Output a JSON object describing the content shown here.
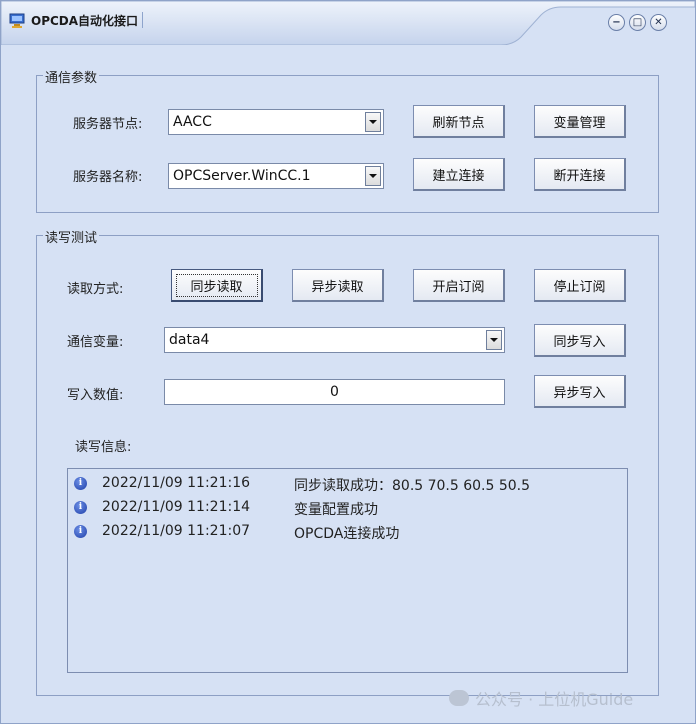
{
  "window": {
    "title": "OPCDA自动化接口",
    "controls": [
      "−",
      "□",
      "✕"
    ]
  },
  "comm_params": {
    "title": "通信参数",
    "server_node_label": "服务器节点:",
    "server_node_value": "AACC",
    "server_name_label": "服务器名称:",
    "server_name_value": "OPCServer.WinCC.1",
    "refresh_nodes": "刷新节点",
    "variable_manage": "变量管理",
    "connect": "建立连接",
    "disconnect": "断开连接"
  },
  "rw_test": {
    "title": "读写测试",
    "read_mode_label": "读取方式:",
    "sync_read": "同步读取",
    "async_read": "异步读取",
    "start_subscribe": "开启订阅",
    "stop_subscribe": "停止订阅",
    "variable_label": "通信变量:",
    "variable_value": "data4",
    "sync_write": "同步写入",
    "write_value_label": "写入数值:",
    "write_value": "0",
    "async_write": "异步写入",
    "info_label": "读写信息:"
  },
  "log": [
    {
      "time": "2022/11/09 11:21:16",
      "message": "同步读取成功：80.5 70.5 60.5 50.5",
      "icon": "info-icon"
    },
    {
      "time": "2022/11/09 11:21:14",
      "message": "变量配置成功",
      "icon": "info-icon"
    },
    {
      "time": "2022/11/09 11:21:07",
      "message": "OPCDA连接成功",
      "icon": "info-icon"
    }
  ],
  "watermark": "公众号 · 上位机Guide",
  "colors": {
    "window_bg": "#d6e1f4",
    "border": "#8d9fc4",
    "info_icon": "#1f3fa8"
  }
}
